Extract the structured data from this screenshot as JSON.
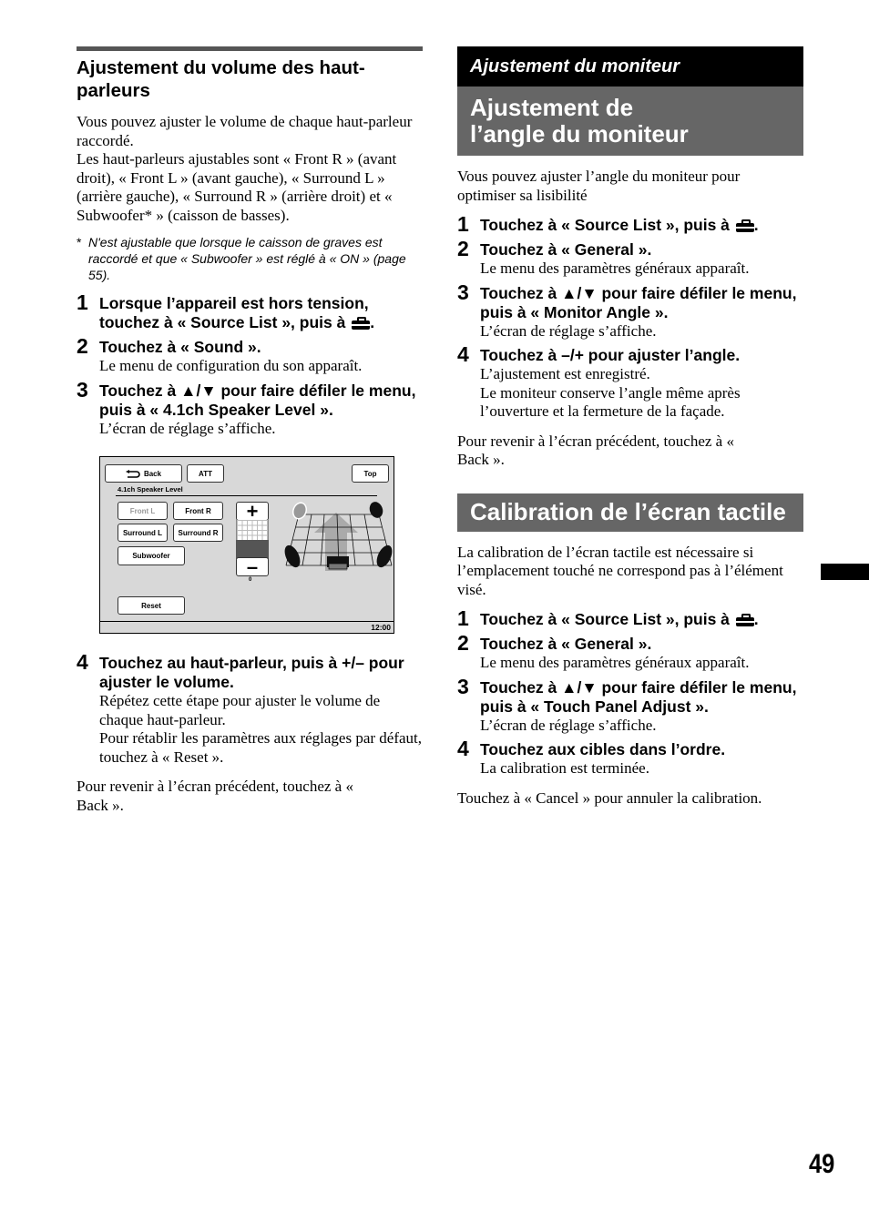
{
  "left_column": {
    "heading": "Ajustement du volume des haut-parleurs",
    "intro_paragraphs": [
      "Vous pouvez ajuster le volume de chaque haut-parleur raccordé.",
      "Les haut-parleurs ajustables sont « Front R » (avant droit), « Front L » (avant gauche), « Surround L » (arrière gauche), « Surround R » (arrière droit) et « Subwoofer* » (caisson de basses)."
    ],
    "footnote": {
      "marker": "*",
      "text": "N'est ajustable que lorsque le caisson de graves est raccordé et que « Subwoofer » est réglé à « ON » (page 55)."
    },
    "steps": [
      {
        "num": "1",
        "title": "Lorsque l’appareil est hors tension, touchez à « Source List », puis à",
        "title_icon": "toolbox-icon",
        "title_suffix": ".",
        "desc": ""
      },
      {
        "num": "2",
        "title": "Touchez à « Sound ».",
        "desc": "Le menu de configuration du son apparaît."
      },
      {
        "num": "3",
        "title": "Touchez à ▲/▼ pour faire défiler le menu, puis à « 4.1ch Speaker Level ».",
        "desc": "L’écran de réglage s’affiche."
      },
      {
        "num": "4",
        "title": "Touchez au haut-parleur, puis à +/– pour ajuster le volume.",
        "desc_lines": [
          "Répétez cette étape pour ajuster le volume de chaque haut-parleur.",
          "Pour rétablir les paramètres aux réglages par défaut, touchez à « Reset »."
        ]
      }
    ],
    "closing": "Pour revenir à l’écran précédent, touchez à « Back »."
  },
  "screen": {
    "back_label": "Back",
    "att_label": "ATT",
    "top_label": "Top",
    "title": "4.1ch Speaker Level",
    "speakers": [
      "Front L",
      "Front R",
      "Surround L",
      "Surround R",
      "Subwoofer"
    ],
    "selected_speaker": "Front L",
    "plus_label": "+",
    "minus_label": "–",
    "level_value": "0",
    "reset_label": "Reset",
    "clock": "12:00"
  },
  "right_column": {
    "chapter_banner": "Ajustement du moniteur",
    "section1": {
      "heading": "Ajustement de l’angle du moniteur",
      "intro": "Vous pouvez ajuster l’angle du moniteur pour optimiser sa lisibilité",
      "steps": [
        {
          "num": "1",
          "title": "Touchez à « Source List », puis à",
          "title_icon": "toolbox-icon",
          "title_suffix": "."
        },
        {
          "num": "2",
          "title": "Touchez à « General ».",
          "desc": "Le menu des paramètres généraux apparaît."
        },
        {
          "num": "3",
          "title": "Touchez à ▲/▼ pour faire défiler le menu, puis à « Monitor Angle ».",
          "desc": "L’écran de réglage s’affiche."
        },
        {
          "num": "4",
          "title": "Touchez à –/+  pour ajuster l’angle.",
          "desc_lines": [
            "L’ajustement est enregistré.",
            "Le moniteur conserve l’angle même après l’ouverture et la fermeture de la façade."
          ]
        }
      ],
      "closing": "Pour revenir à l’écran précédent, touchez à « Back »."
    },
    "section2": {
      "heading": "Calibration de l’écran tactile",
      "intro": "La calibration de l’écran tactile est nécessaire si l’emplacement touché ne correspond pas à l’élément visé.",
      "steps": [
        {
          "num": "1",
          "title": "Touchez à « Source List », puis à",
          "title_icon": "toolbox-icon",
          "title_suffix": "."
        },
        {
          "num": "2",
          "title": "Touchez à « General ».",
          "desc": "Le menu des paramètres généraux apparaît."
        },
        {
          "num": "3",
          "title": "Touchez à ▲/▼ pour faire défiler le menu, puis à « Touch Panel Adjust ».",
          "desc": "L’écran de réglage s’affiche."
        },
        {
          "num": "4",
          "title": "Touchez aux cibles dans l’ordre.",
          "desc": "La calibration est terminée."
        }
      ],
      "closing": "Touchez à « Cancel » pour annuler la calibration."
    }
  },
  "page_number": "49"
}
